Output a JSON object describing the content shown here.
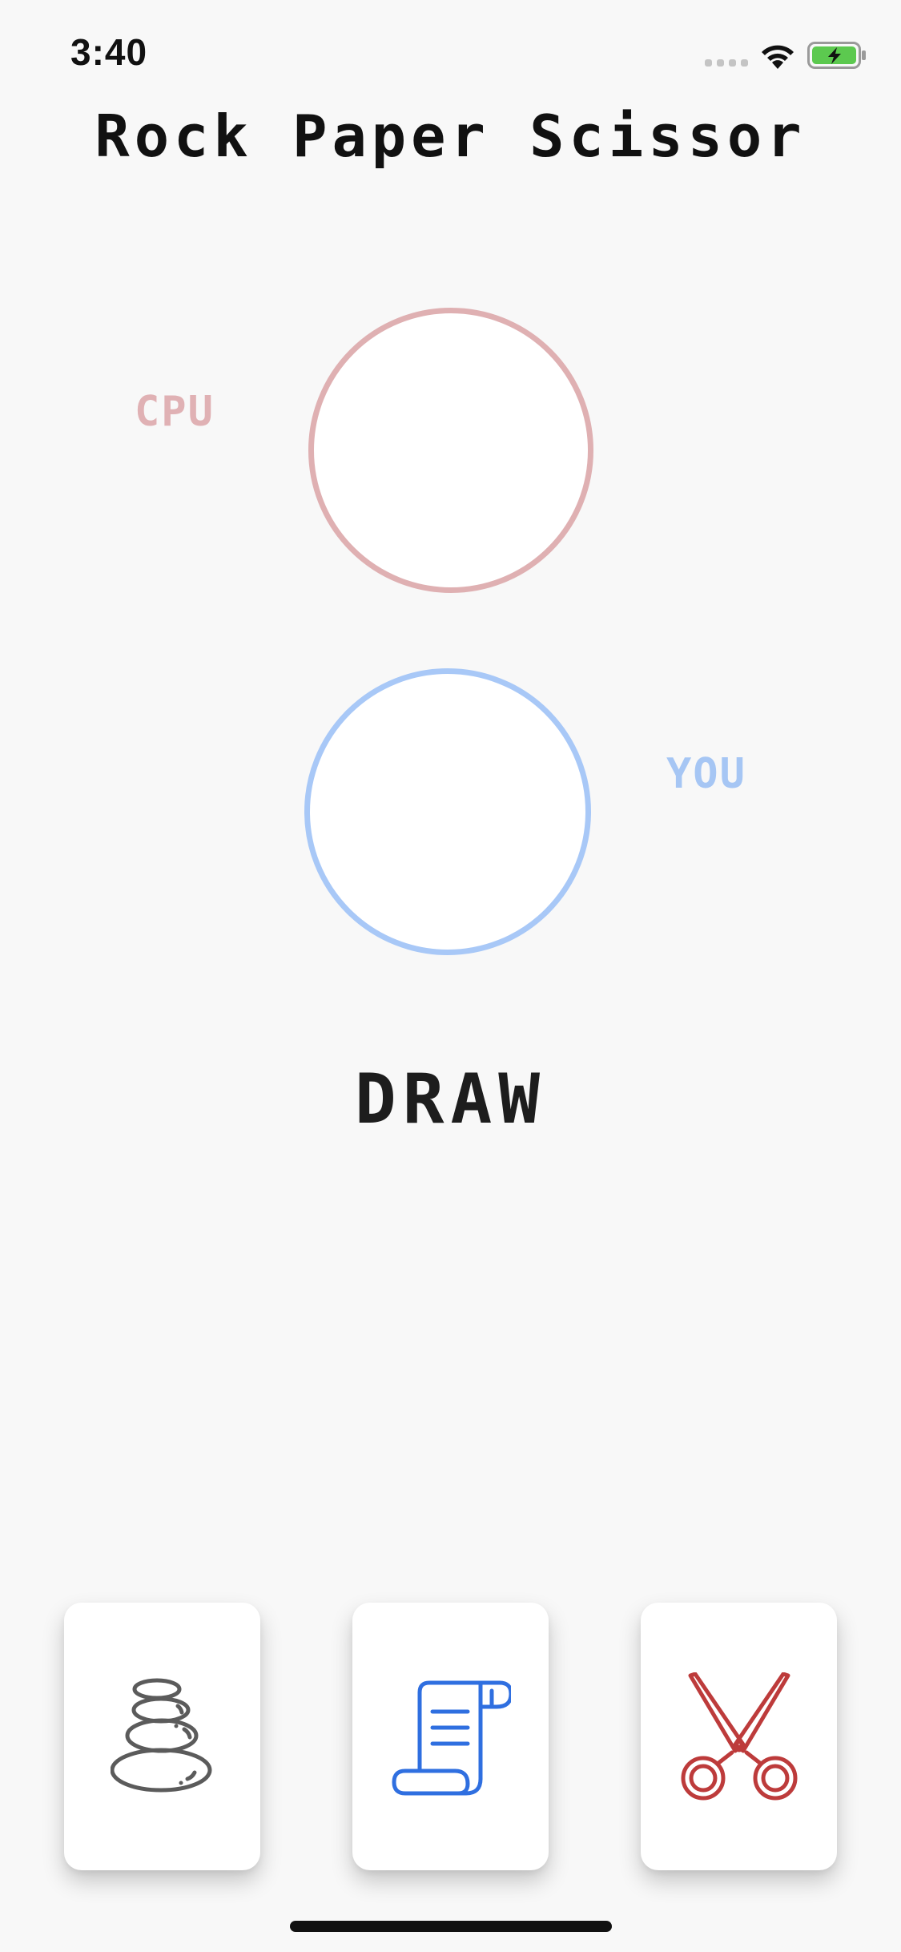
{
  "status_bar": {
    "time": "3:40",
    "battery_color": "#5cc94f"
  },
  "title": "Rock Paper Scissor",
  "cpu": {
    "label": "CPU",
    "color": "#e0b1b4"
  },
  "player": {
    "label": "YOU",
    "color": "#a6c6f4"
  },
  "result": "DRAW",
  "choices": [
    {
      "id": "rock",
      "icon": "rock-stack-icon",
      "color": "#5b5b5b"
    },
    {
      "id": "paper",
      "icon": "paper-scroll-icon",
      "color": "#2f6fe0"
    },
    {
      "id": "scissor",
      "icon": "scissors-icon",
      "color": "#bd3b3b"
    }
  ]
}
